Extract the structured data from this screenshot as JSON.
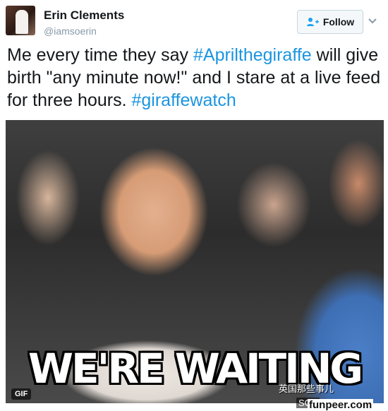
{
  "user": {
    "name": "Erin Clements",
    "handle": "@iamsoerin",
    "avatar_icon": "profile-photo"
  },
  "follow_button": {
    "label": "Follow",
    "icon": "add-user-icon"
  },
  "tweet": {
    "parts": [
      {
        "text": "Me every time they say ",
        "type": "text"
      },
      {
        "text": "#Aprilthegiraffe",
        "type": "hashtag"
      },
      {
        "text": " will give birth \"any minute now!\" and I stare at a live feed for three hours. ",
        "type": "text"
      },
      {
        "text": "#giraffewatch",
        "type": "hashtag"
      }
    ]
  },
  "media": {
    "caption": "WE'RE WAITING",
    "badge": "GIF"
  },
  "watermarks": {
    "chinese_label": "英国那些事儿",
    "partial": "SOE",
    "site": "funpeer.com"
  },
  "colors": {
    "hashtag": "#1b95e0",
    "text": "#14171a",
    "muted": "#8899a6"
  }
}
